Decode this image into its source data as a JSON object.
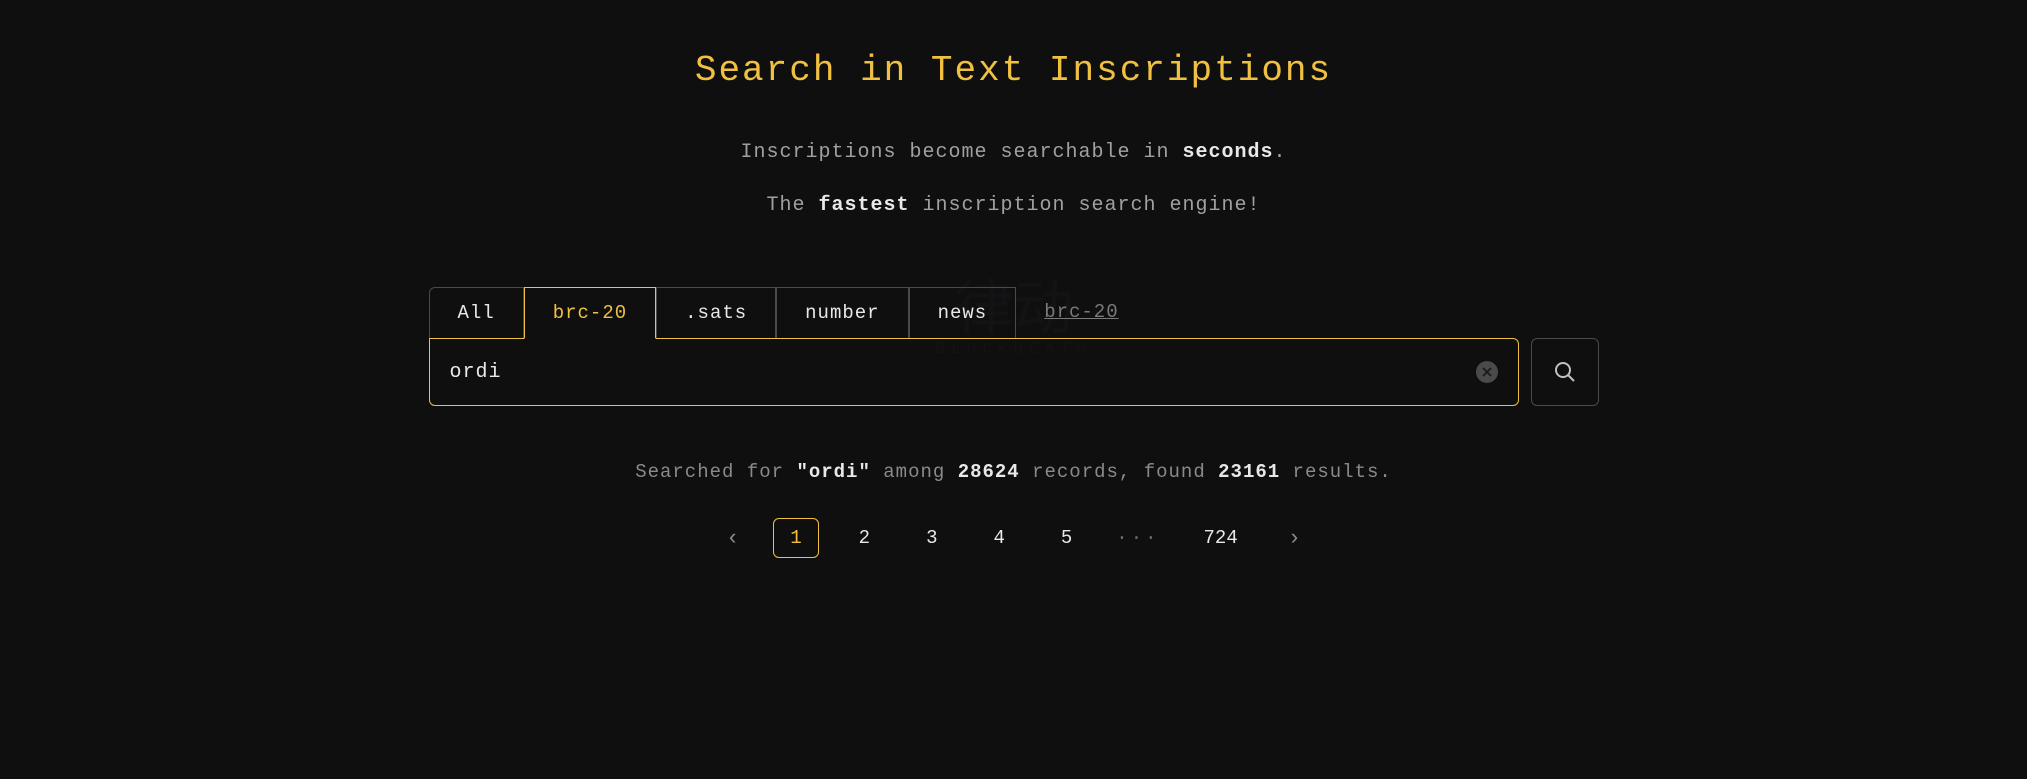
{
  "header": {
    "title": "Search in Text Inscriptions",
    "subtitle1_pre": "Inscriptions become searchable in ",
    "subtitle1_bold": "seconds",
    "subtitle1_post": ".",
    "subtitle2_pre": "The ",
    "subtitle2_bold": "fastest",
    "subtitle2_post": " inscription search engine!"
  },
  "tabs": {
    "items": [
      {
        "label": "All",
        "active": false
      },
      {
        "label": "brc-20",
        "active": true
      },
      {
        "label": ".sats",
        "active": false
      },
      {
        "label": "number",
        "active": false
      },
      {
        "label": "news",
        "active": false
      }
    ],
    "breadcrumb": "brc-20"
  },
  "search": {
    "value": "ordi",
    "placeholder": ""
  },
  "results": {
    "pre": "Searched for ",
    "query": "\"ordi\"",
    "mid1": " among ",
    "total": "28624",
    "mid2": " records, found ",
    "found": "23161",
    "post": " results."
  },
  "pagination": {
    "prev": "‹",
    "pages": [
      "1",
      "2",
      "3",
      "4",
      "5"
    ],
    "ellipsis": "···",
    "last": "724",
    "next": "›",
    "active": "1"
  },
  "watermark": {
    "main": "律动",
    "sub": "BLOCKBEATS"
  }
}
